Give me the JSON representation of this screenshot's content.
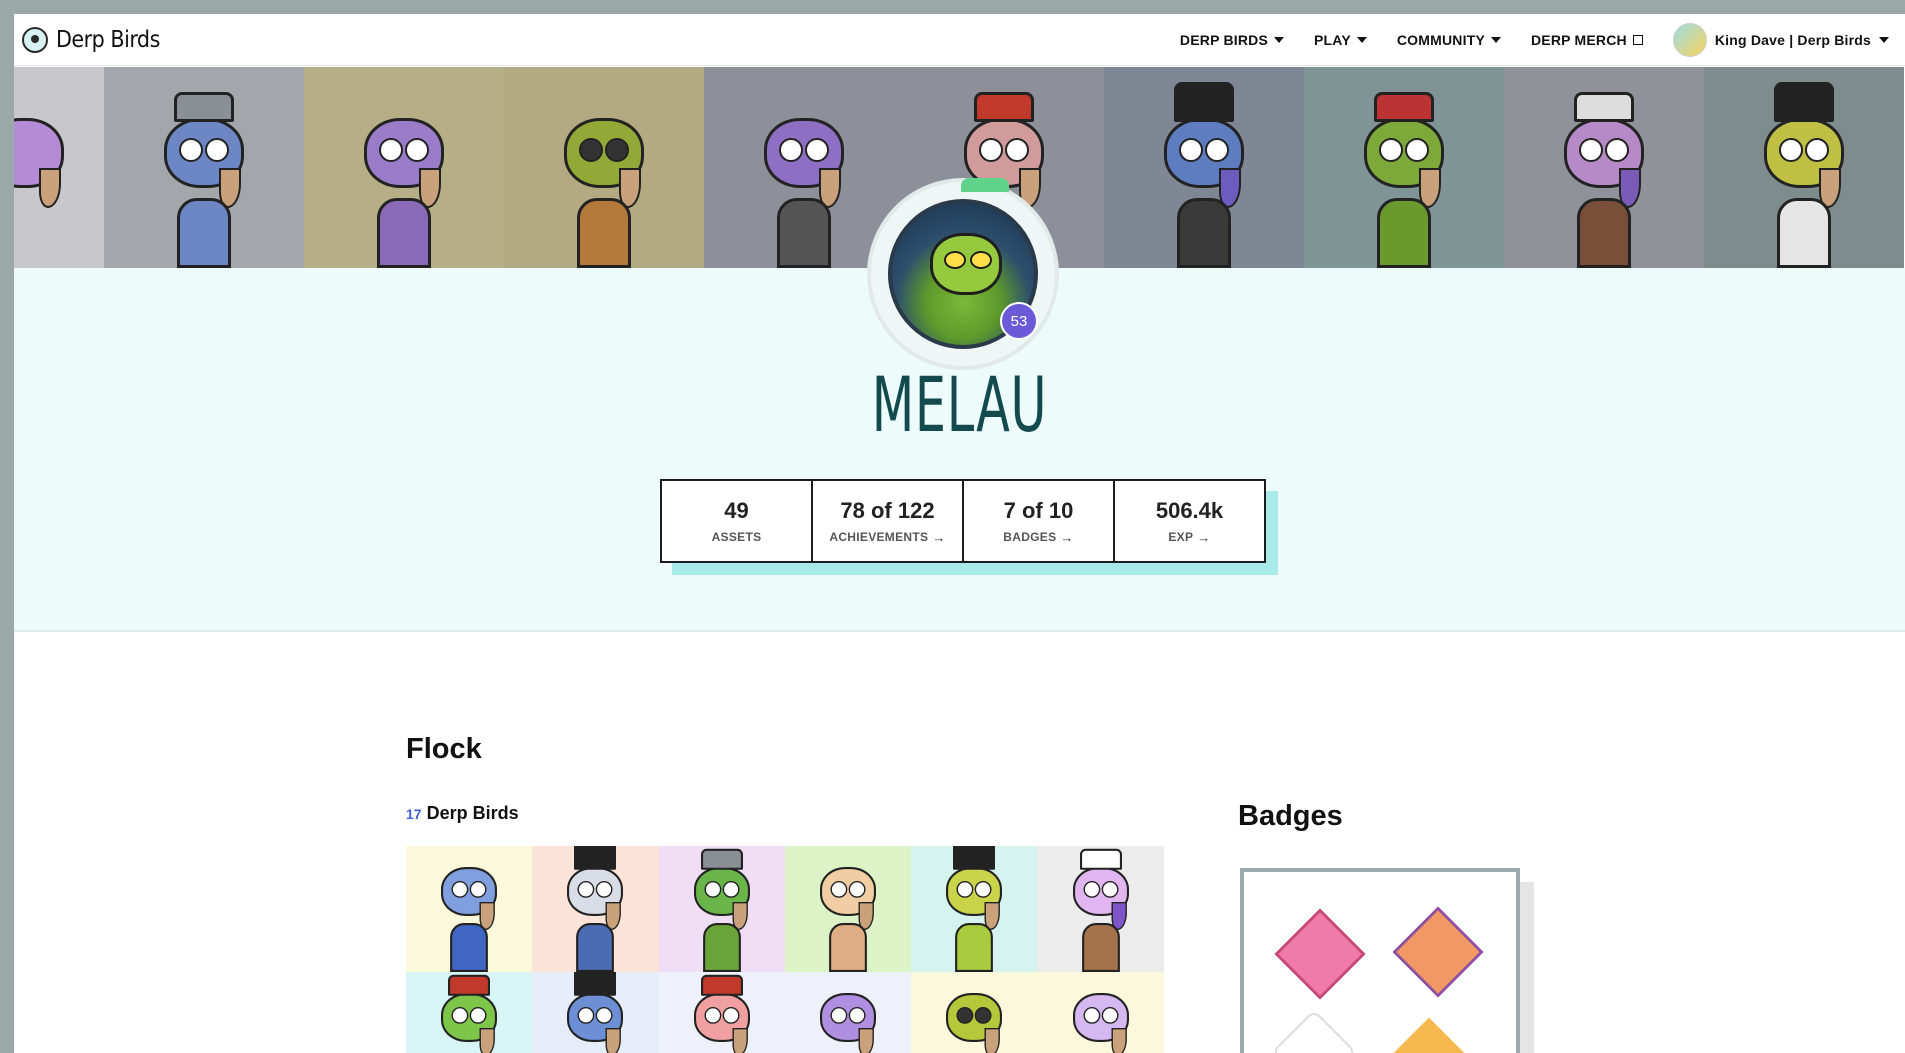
{
  "nav": {
    "brand": "Derp Birds",
    "items": [
      {
        "label": "DERP BIRDS",
        "icon": "caret-down-icon"
      },
      {
        "label": "PLAY",
        "icon": "caret-down-icon"
      },
      {
        "label": "COMMUNITY",
        "icon": "caret-down-icon"
      },
      {
        "label": "DERP MERCH",
        "icon": "external-link-icon"
      }
    ],
    "user": "King Dave | Derp Birds"
  },
  "profile": {
    "name": "MELAU",
    "level": "53"
  },
  "stats": [
    {
      "value": "49",
      "label": "ASSETS",
      "arrow": ""
    },
    {
      "value": "78 of 122",
      "label": "ACHIEVEMENTS",
      "arrow": "→"
    },
    {
      "value": "7 of 10",
      "label": "BADGES",
      "arrow": "→"
    },
    {
      "value": "506.4k",
      "label": "EXP",
      "arrow": "→"
    }
  ],
  "flock": {
    "title": "Flock",
    "count": "17",
    "count_label": "Derp Birds"
  },
  "badges": {
    "title": "Badges"
  },
  "colors": {
    "hero_bg": "#eefbfb",
    "name_color": "#124a4d",
    "level_badge": "#6a5ad8",
    "stats_shadow": "#a8eaea",
    "count_blue": "#3c61d9"
  }
}
